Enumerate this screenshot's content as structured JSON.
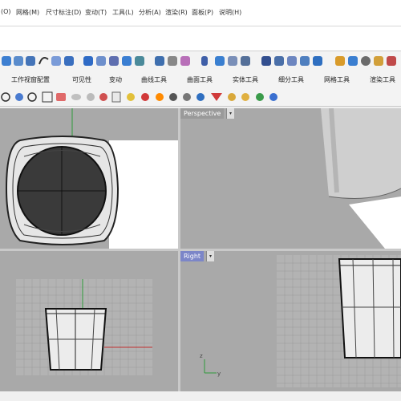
{
  "menubar": {
    "items": [
      "(O)",
      "网格(M)",
      "尺寸标注(D)",
      "变动(T)",
      "工具(L)",
      "分析(A)",
      "渲染(R)",
      "面板(P)",
      "说明(H)"
    ]
  },
  "tabs": [
    "工作视窗配置",
    "可见性",
    "变动",
    "曲线工具",
    "曲面工具",
    "实体工具",
    "细分工具",
    "网格工具",
    "渲染工具"
  ],
  "viewports": {
    "perspective": {
      "label": "Perspective",
      "menu_arrow": "▾"
    },
    "right": {
      "label": "Right",
      "menu_arrow": "▾"
    }
  },
  "axes": {
    "z": "z",
    "y": "y"
  },
  "colors": {
    "viewport_bg": "#a9a9a9",
    "active_label": "#7c86c8",
    "grid_line": "#9b9b9b",
    "axis_green": "#2e9b3a",
    "axis_red": "#c03030"
  }
}
